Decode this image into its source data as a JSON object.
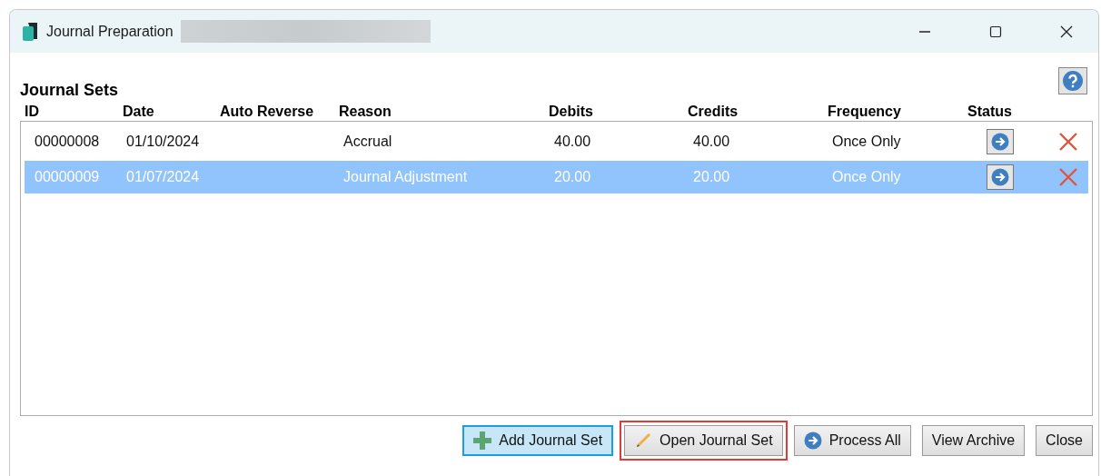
{
  "window": {
    "title": "Journal Preparation"
  },
  "heading": "Journal Sets",
  "table": {
    "columns": [
      "ID",
      "Date",
      "Auto Reverse",
      "Reason",
      "Debits",
      "Credits",
      "Frequency",
      "Status"
    ],
    "rows": [
      {
        "id": "00000008",
        "date": "01/10/2024",
        "reason": "Accrual",
        "debits": "40.00",
        "credits": "40.00",
        "frequency": "Once Only",
        "selected": false
      },
      {
        "id": "00000009",
        "date": "01/07/2024",
        "reason": "Journal Adjustment",
        "debits": "20.00",
        "credits": "20.00",
        "frequency": "Once Only",
        "selected": true
      }
    ]
  },
  "buttons": [
    {
      "label": "Add Journal Set",
      "kind": "add",
      "focused": true,
      "highlighted": false
    },
    {
      "label": "Open Journal Set",
      "kind": "edit",
      "focused": false,
      "highlighted": true
    },
    {
      "label": "Process All",
      "kind": "process",
      "focused": false,
      "highlighted": false
    },
    {
      "label": "View Archive",
      "kind": "plain",
      "focused": false,
      "highlighted": false
    },
    {
      "label": "Close",
      "kind": "plain",
      "focused": false,
      "highlighted": false
    }
  ]
}
